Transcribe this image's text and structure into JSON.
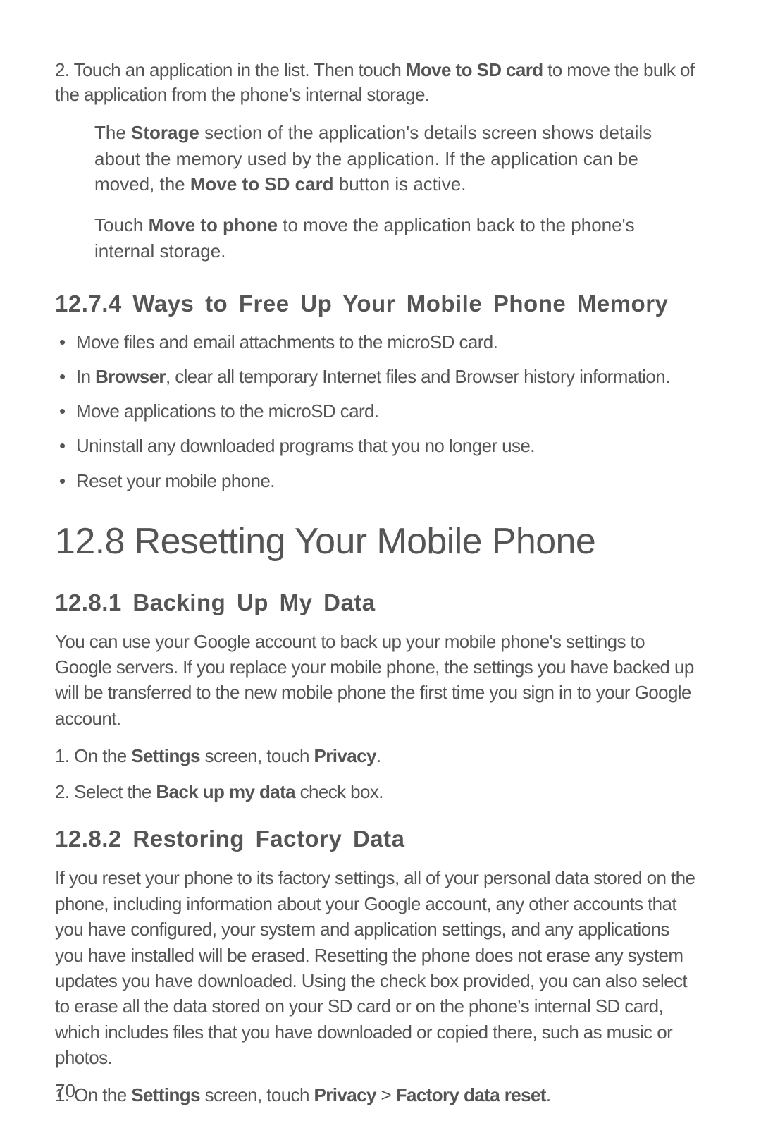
{
  "page_number": "70",
  "step2": {
    "num": "2.",
    "pre": " Touch an application in the list. Then touch ",
    "b1": "Move to SD card",
    "post": " to move the bulk of the application from the phone's internal storage."
  },
  "note1": {
    "t1": "The ",
    "b1": "Storage",
    "t2": " section of the application's details screen shows details about the memory used by the application. If the application can be moved, the ",
    "b2": "Move to SD card",
    "t3": " button is active."
  },
  "note2": {
    "t1": "Touch ",
    "b1": "Move to phone",
    "t2": " to move the application back to the phone's internal storage."
  },
  "h_1274": "12.7.4  Ways to Free Up Your Mobile Phone Memory",
  "bullets_1274": {
    "i0": "Move files and email attachments to the microSD card.",
    "i1_pre": "In ",
    "i1_b": "Browser",
    "i1_post": ", clear all temporary Internet files and Browser history information.",
    "i2": "Move applications to the microSD card.",
    "i3": "Uninstall any downloaded programs that you no longer use.",
    "i4": "Reset your mobile phone."
  },
  "h_128": "12.8  Resetting Your Mobile Phone",
  "h_1281": "12.8.1  Backing Up My Data",
  "p_1281": "You can use your Google account to back up your mobile phone's settings to Google servers. If you replace your mobile phone, the settings you have backed up will be transferred to the new mobile phone the first time you sign in to your Google account.",
  "steps_1281": {
    "s1_num": "1.",
    "s1_t1": " On the ",
    "s1_b1": "Settings",
    "s1_t2": " screen, touch ",
    "s1_b2": "Privacy",
    "s1_t3": ".",
    "s2_num": "2.",
    "s2_t1": " Select the ",
    "s2_b1": "Back up my data",
    "s2_t2": " check box."
  },
  "h_1282": "12.8.2  Restoring Factory Data",
  "p_1282": "If you reset your phone to its factory settings, all of your personal data stored on the phone, including information about your Google account, any other accounts that you have configured, your system and application settings, and any applications you have installed will be erased. Resetting the phone does not erase any system updates you have downloaded. Using the check box provided, you can also select to erase all the data stored on your SD card or on the phone's internal SD card, which includes files that you have downloaded or copied there, such as music or photos.",
  "steps_1282": {
    "s1_num": "1.",
    "s1_t1": " On the ",
    "s1_b1": "Settings",
    "s1_t2": " screen, touch ",
    "s1_b2": "Privacy",
    "s1_t3": " > ",
    "s1_b3": "Factory data reset",
    "s1_t4": "."
  }
}
